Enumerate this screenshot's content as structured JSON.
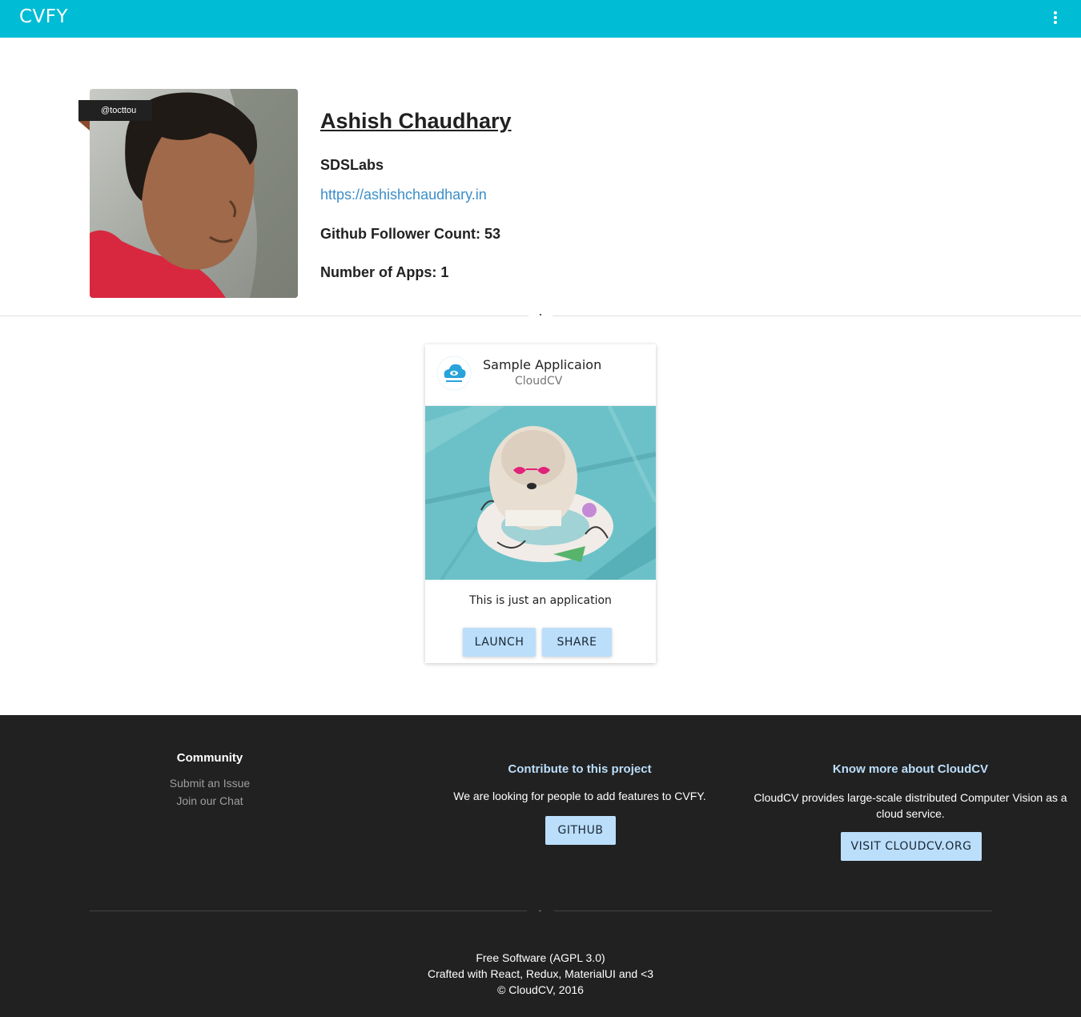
{
  "appbar": {
    "title": "CVFY",
    "menu_icon": "more-vert-icon",
    "color": "#00bcd4"
  },
  "profile": {
    "handle": "@tocttou",
    "name": "Ashish Chaudhary",
    "organization": "SDSLabs",
    "website": "https://ashishchaudhary.in",
    "followers_line": "Github Follower Count: 53",
    "apps_line": "Number of Apps: 1"
  },
  "app_card": {
    "title": "Sample Applicaion",
    "owner": "CloudCV",
    "logo_icon": "cloudcv-logo-icon",
    "description": "This is just an application",
    "launch_label": "LAUNCH",
    "share_label": "SHARE"
  },
  "footer": {
    "community": {
      "title": "Community",
      "links": [
        "Submit an Issue",
        "Join our Chat"
      ]
    },
    "contribute": {
      "title": "Contribute to this project",
      "text": "We are looking for people to add features to CVFY.",
      "button_label": "GITHUB"
    },
    "about": {
      "title": "Know more about CloudCV",
      "text": "CloudCV provides large-scale distributed Computer Vision as a cloud service.",
      "button_label": "VISIT CLOUDCV.ORG"
    },
    "bottom": {
      "license": "Free Software (AGPL 3.0)",
      "crafted": "Crafted with React, Redux, MaterialUI and <3",
      "copyright": "© CloudCV, 2016"
    }
  },
  "colors": {
    "accent": "#00bcd4",
    "button": "#bbdefb",
    "link": "#3b8ec8",
    "footer_bg": "#212121"
  }
}
